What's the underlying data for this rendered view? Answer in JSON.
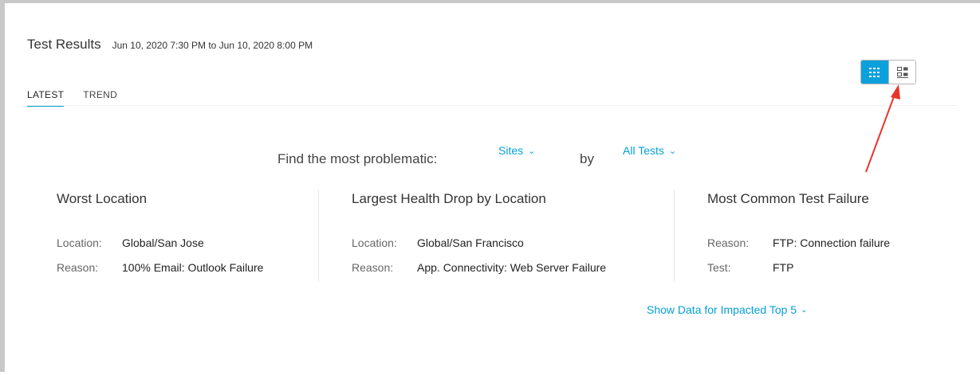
{
  "header": {
    "title": "Test Results",
    "time_range": "Jun 10, 2020 7:30 PM to Jun 10, 2020 8:00 PM"
  },
  "tabs": [
    {
      "label": "LATEST",
      "active": true
    },
    {
      "label": "TREND",
      "active": false
    }
  ],
  "view_toggle": {
    "grid_icon": "grid-view-icon",
    "dashboard_icon": "dashboard-view-icon",
    "active": "grid"
  },
  "finder": {
    "label": "Find the most problematic:",
    "dimension": "Sites",
    "by": "by",
    "test_filter": "All Tests"
  },
  "cards": [
    {
      "title": "Worst Location",
      "rows": [
        {
          "label": "Location:",
          "value": "Global/San Jose"
        },
        {
          "label": "Reason:",
          "value": "100% Email: Outlook Failure"
        }
      ]
    },
    {
      "title": "Largest Health Drop by Location",
      "rows": [
        {
          "label": "Location:",
          "value": "Global/San Francisco"
        },
        {
          "label": "Reason:",
          "value": "App. Connectivity: Web Server Failure"
        }
      ]
    },
    {
      "title": "Most Common Test Failure",
      "rows": [
        {
          "label": "Reason:",
          "value": "FTP: Connection failure"
        },
        {
          "label": "Test:",
          "value": "FTP"
        }
      ]
    }
  ],
  "show_data": {
    "label": "Show Data for Impacted Top 5"
  },
  "colors": {
    "accent": "#049fd9",
    "annotation_arrow": "#e8352b",
    "frame": "#c8c8c8"
  }
}
